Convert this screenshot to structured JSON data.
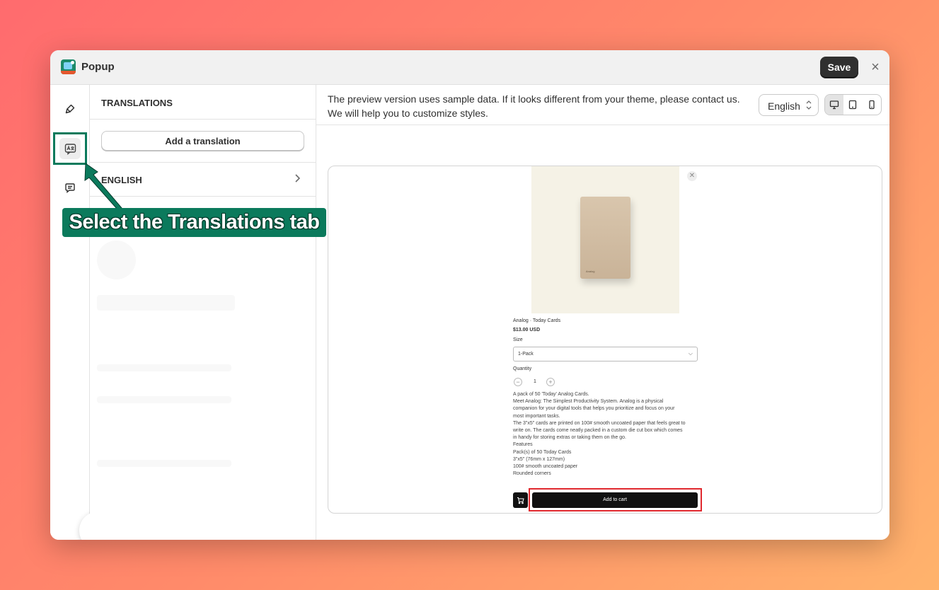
{
  "window": {
    "title": "Popup",
    "save_label": "Save",
    "close_glyph": "×"
  },
  "rail": {
    "items": [
      {
        "name": "design",
        "icon": "brush-icon"
      },
      {
        "name": "translations",
        "icon": "translate-icon",
        "active": true
      },
      {
        "name": "messages",
        "icon": "chat-icon"
      }
    ],
    "help_icon": "question-circle-icon"
  },
  "panel": {
    "title": "TRANSLATIONS",
    "add_label": "Add a translation",
    "languages": [
      {
        "label": "ENGLISH"
      }
    ]
  },
  "preview": {
    "notice_line1": "The preview version uses sample data. If it looks different from your theme, please contact us.",
    "notice_line2": "We will help you to customize styles.",
    "language": "English",
    "devices": [
      "desktop-icon",
      "tablet-icon",
      "mobile-icon"
    ],
    "active_device": "desktop-icon"
  },
  "product": {
    "box_brand": "Analog",
    "vendor_title": "Analog · Today Cards",
    "price": "$13.00 USD",
    "size_label": "Size",
    "size_value": "1-Pack",
    "quantity_label": "Quantity",
    "quantity_value": "1",
    "minus": "−",
    "plus": "+",
    "description": [
      "A pack of 50 'Today' Analog Cards.",
      "Meet Analog: The Simplest Productivity System. Analog is a physical",
      "companion for your digital tools that helps you prioritize and focus on your",
      "most important tasks.",
      "The 3\"x5\" cards are printed on 100# smooth uncoated paper that feels great to",
      "write on. The cards come neatly packed in a custom die cut box which comes",
      "in handy for storing extras or taking them on the go.",
      "Features",
      "Pack(s) of 50 Today Cards",
      "3\"x5\" (76mm x 127mm)",
      "100# smooth uncoated paper",
      "Rounded corners"
    ],
    "add_to_cart": "Add to cart"
  },
  "annotation": {
    "callout": "Select the Translations tab",
    "color": "#0b7a5c",
    "highlight_color": "#e0282e"
  }
}
